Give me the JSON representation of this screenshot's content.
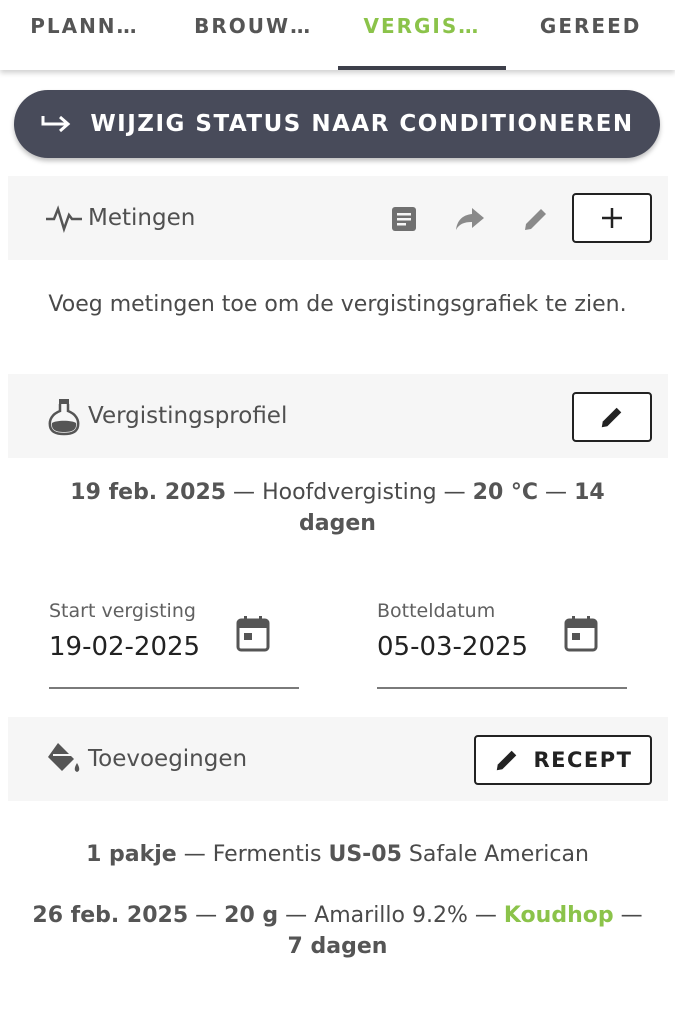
{
  "tabs": [
    {
      "label": "PLANN…",
      "active": false
    },
    {
      "label": "BROUW…",
      "active": false
    },
    {
      "label": "VERGIS…",
      "active": true
    },
    {
      "label": "GEREED",
      "active": false
    }
  ],
  "status_button": {
    "label": "WIJZIG STATUS NAAR CONDITIONEREN",
    "icon": "arrow-right-icon"
  },
  "measurements": {
    "title": "Metingen",
    "empty_text": "Voeg metingen toe om de vergistingsgrafiek te zien.",
    "icons": [
      "notes-icon",
      "share-icon",
      "edit-icon",
      "add-icon"
    ]
  },
  "profile": {
    "title": "Vergistingsprofiel",
    "date": "19 feb. 2025",
    "sep1": " — ",
    "step": "Hoofdvergisting",
    "sep2": " — ",
    "temp": "20 °C",
    "sep3": " — ",
    "duration": "14 dagen"
  },
  "fields": {
    "start_label": "Start vergisting",
    "start_value": "19-02-2025",
    "bottle_label": "Botteldatum",
    "bottle_value": "05-03-2025"
  },
  "additions": {
    "title": "Toevoegingen",
    "recipe_button": "RECEPT",
    "item1": {
      "amount": "1 pakje",
      "sep": " — ",
      "brand": "Fermentis ",
      "code": "US-05",
      "name": " Safale American"
    },
    "item2": {
      "date": "26 feb. 2025",
      "sep1": " — ",
      "amount": "20 g",
      "sep2": " — ",
      "name": "Amarillo 9.2%",
      "sep3": " — ",
      "type": "Koudhop",
      "sep4": " —",
      "duration": "7 dagen"
    }
  },
  "colors": {
    "accent": "#8bc34a",
    "button": "#484b5a"
  }
}
